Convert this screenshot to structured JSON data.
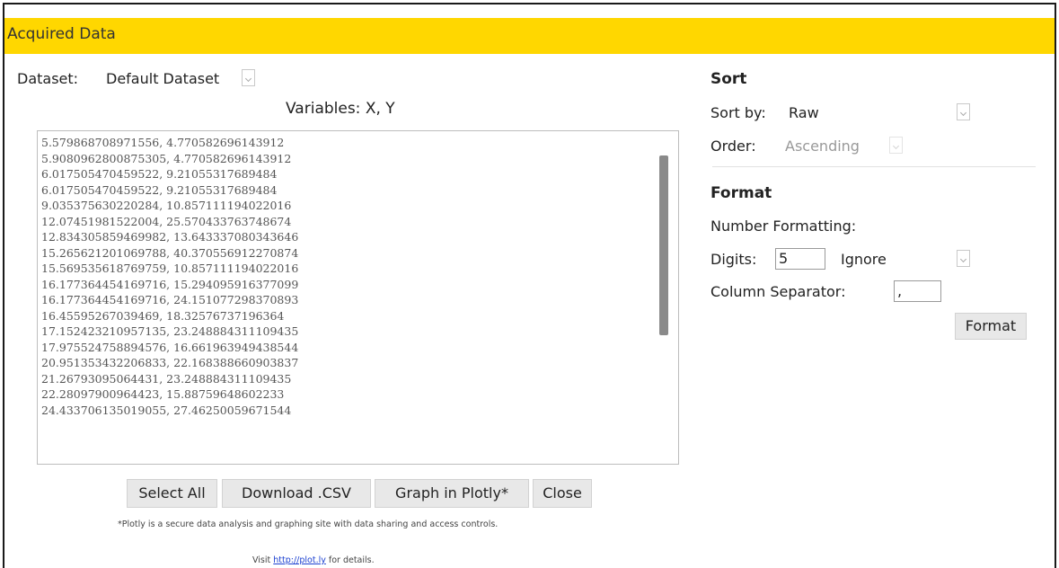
{
  "window": {
    "title": "Acquired Data"
  },
  "dataset": {
    "label": "Dataset:",
    "value": "Default Dataset"
  },
  "variables": {
    "label": "Variables: X, Y"
  },
  "data_rows": [
    "5.579868708971556, 4.770582696143912",
    "5.9080962800875305, 4.770582696143912",
    "6.017505470459522, 9.21055317689484",
    "6.017505470459522, 9.21055317689484",
    "9.035375630220284, 10.857111194022016",
    "12.07451981522004, 25.570433763748674",
    "12.834305859469982, 13.643337080343646",
    "15.265621201069788, 40.370556912270874",
    "15.569535618769759, 10.857111194022016",
    "16.177364454169716, 15.294095916377099",
    "16.177364454169716, 24.151077298370893",
    "16.45595267039469, 18.32576737196364",
    "17.152423210957135, 23.248884311109435",
    "17.975524758894576, 16.661963949438544",
    "20.951353432206833, 22.168388660903837",
    "21.26793095064431, 23.248884311109435",
    "22.28097900964423, 15.88759648602233",
    "24.433706135019055, 27.46250059671544"
  ],
  "buttons": {
    "select_all": "Select All",
    "download_csv": "Download .CSV",
    "graph_plotly": "Graph in Plotly*",
    "close": "Close"
  },
  "footnote": {
    "plotly_note": "*Plotly is a secure data analysis and graphing site with data sharing and access controls.",
    "visit_prefix": "Visit ",
    "visit_link": "http://plot.ly",
    "visit_suffix": " for details."
  },
  "sort": {
    "heading": "Sort",
    "sort_by_label": "Sort by:",
    "sort_by_value": "Raw",
    "order_label": "Order:",
    "order_value": "Ascending"
  },
  "format": {
    "heading": "Format",
    "number_formatting_label": "Number Formatting:",
    "digits_label": "Digits:",
    "digits_value": "5",
    "digits_mode": "Ignore",
    "column_separator_label": "Column Separator:",
    "column_separator_value": ",",
    "format_button": "Format"
  },
  "colors": {
    "titlebar": "#ffd700",
    "link": "#1a3fd0"
  }
}
